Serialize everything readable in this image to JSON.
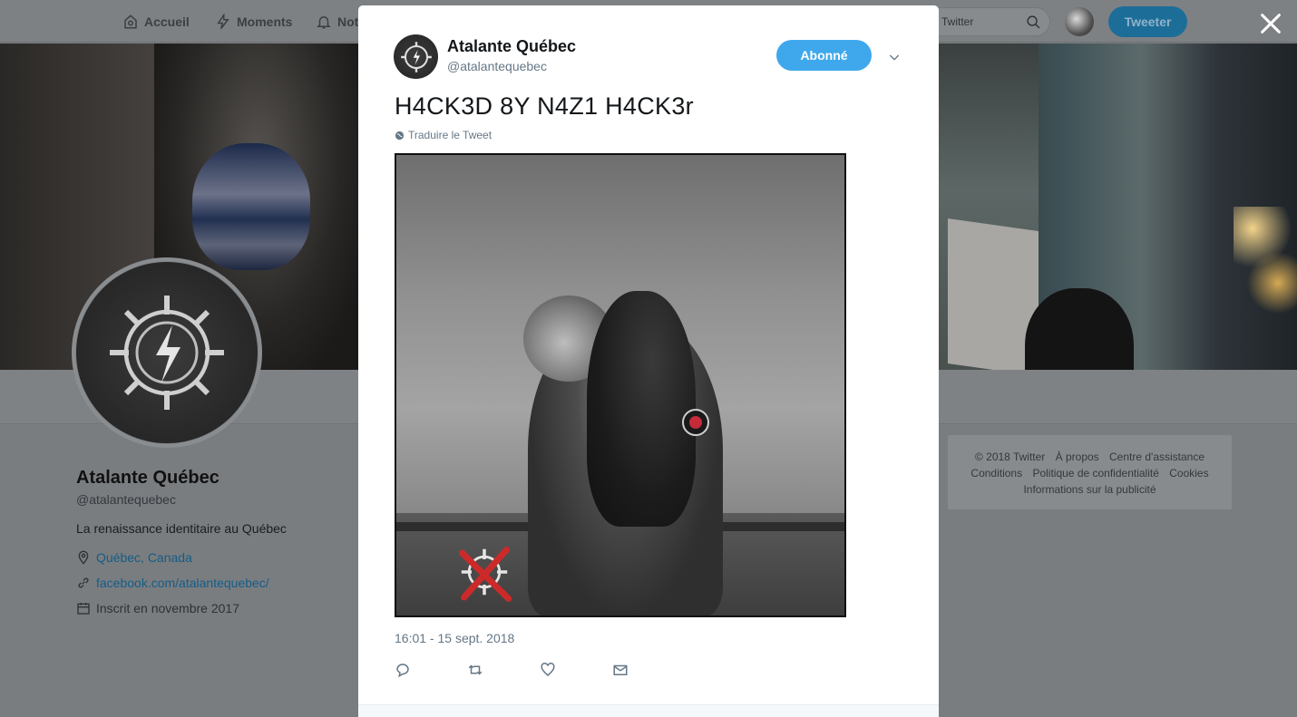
{
  "nav": {
    "home": "Accueil",
    "moments": "Moments",
    "notifications": "Noti",
    "search_placeholder": "Twitter",
    "tweet_button": "Tweeter"
  },
  "profile": {
    "name": "Atalante Québec",
    "handle": "@atalantequebec",
    "bio": "La renaissance identitaire au Québec",
    "location": "Québec, Canada",
    "website": "facebook.com/atalantequebec/",
    "joined": "Inscrit en novembre 2017"
  },
  "footer": {
    "line1": [
      "© 2018 Twitter",
      "À propos",
      "Centre d'assistance"
    ],
    "line2": [
      "Conditions",
      "Politique de confidentialité",
      "Cookies"
    ],
    "line3": [
      "Informations sur la publicité"
    ]
  },
  "tweet": {
    "author_name": "Atalante Québec",
    "author_handle": "@atalantequebec",
    "follow_label": "Abonné",
    "text": "H4CK3D 8Y N4Z1 H4CK3r",
    "translate": "Traduire le Tweet",
    "timestamp": "16:01 - 15 sept. 2018"
  },
  "colors": {
    "accent": "#3fa8ec",
    "overlay_bg": "#7a7d80",
    "link_dimmed": "#155d86"
  },
  "icons": [
    "home-icon",
    "lightning-icon",
    "bell-icon",
    "search-icon",
    "close-icon",
    "chevron-down-icon",
    "globe-icon",
    "reply-icon",
    "retweet-icon",
    "like-icon",
    "message-icon",
    "location-icon",
    "link-icon",
    "calendar-icon"
  ]
}
